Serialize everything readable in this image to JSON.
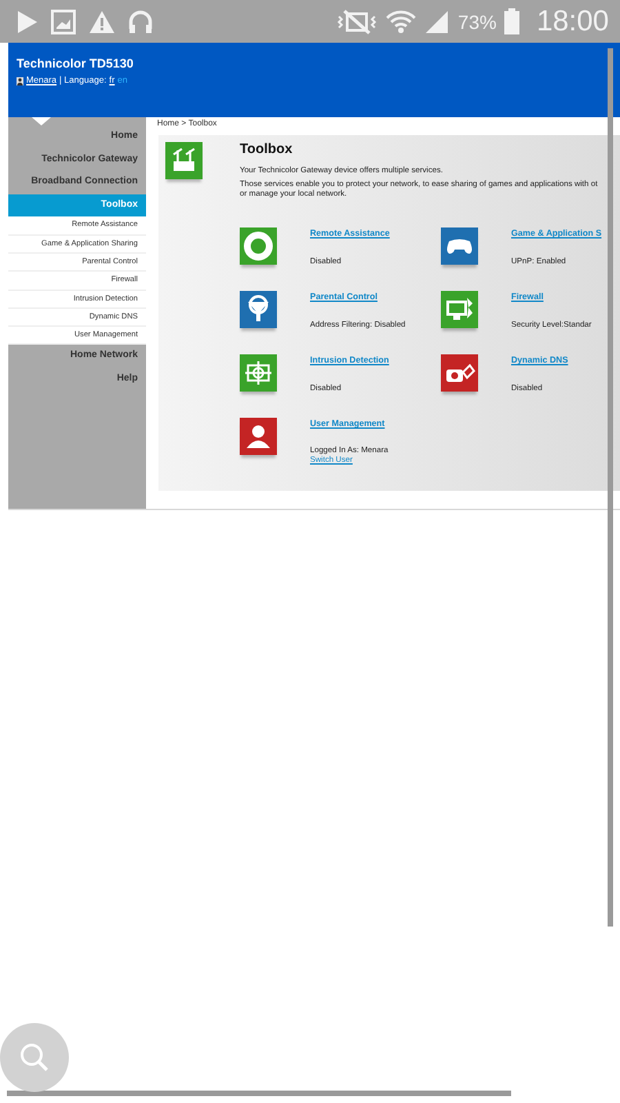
{
  "status_bar": {
    "battery": "73%",
    "time": "18:00"
  },
  "header": {
    "title": "Technicolor TD5130",
    "user": "Menara",
    "language_label": "| Language:",
    "languages": [
      {
        "label": "fr",
        "selected": false
      },
      {
        "label": "en",
        "selected": true
      }
    ]
  },
  "sidebar": {
    "items": [
      {
        "label": "Home",
        "selected": false,
        "kind": "section"
      },
      {
        "label": "Technicolor Gateway",
        "selected": false,
        "kind": "section"
      },
      {
        "label": "Broadband Connection",
        "selected": false,
        "kind": "section"
      },
      {
        "label": "Toolbox",
        "selected": true,
        "kind": "section"
      },
      {
        "label": "Remote Assistance",
        "selected": false,
        "kind": "sub"
      },
      {
        "label": "Game & Application Sharing",
        "selected": false,
        "kind": "sub"
      },
      {
        "label": "Parental Control",
        "selected": false,
        "kind": "sub"
      },
      {
        "label": "Firewall",
        "selected": false,
        "kind": "sub"
      },
      {
        "label": "Intrusion Detection",
        "selected": false,
        "kind": "sub"
      },
      {
        "label": "Dynamic DNS",
        "selected": false,
        "kind": "sub"
      },
      {
        "label": "User Management",
        "selected": false,
        "kind": "sub"
      },
      {
        "label": "Home Network",
        "selected": false,
        "kind": "section"
      },
      {
        "label": "Help",
        "selected": false,
        "kind": "section"
      }
    ]
  },
  "breadcrumb": "Home > Toolbox",
  "toolbox": {
    "title": "Toolbox",
    "intro": "Your Technicolor Gateway device offers multiple services.",
    "description": [
      "Those services enable you to protect your network, to ease sharing of games and applications with ot",
      "or manage your local network."
    ],
    "services": [
      {
        "name": "Remote Assistance",
        "status": "Disabled",
        "kind": "lifebuoy",
        "color": "#3aa32a"
      },
      {
        "name": "Game & Application S",
        "status": "UPnP: Enabled",
        "kind": "gamepad",
        "color": "#1f6fb0"
      },
      {
        "name": "Parental Control",
        "status": "Address Filtering: Disabled",
        "kind": "filter",
        "color": "#1f6fb0"
      },
      {
        "name": "Firewall",
        "status": "Security Level:Standar",
        "kind": "firewall",
        "color": "#3aa32a"
      },
      {
        "name": "Intrusion Detection",
        "status": "Disabled",
        "kind": "target",
        "color": "#3aa32a"
      },
      {
        "name": "Dynamic DNS",
        "status": "Disabled",
        "kind": "camera",
        "color": "#c42424"
      },
      {
        "name": "User Management",
        "status": "Logged In As: Menara",
        "link": "Switch User",
        "kind": "user",
        "color": "#c42424"
      }
    ]
  }
}
